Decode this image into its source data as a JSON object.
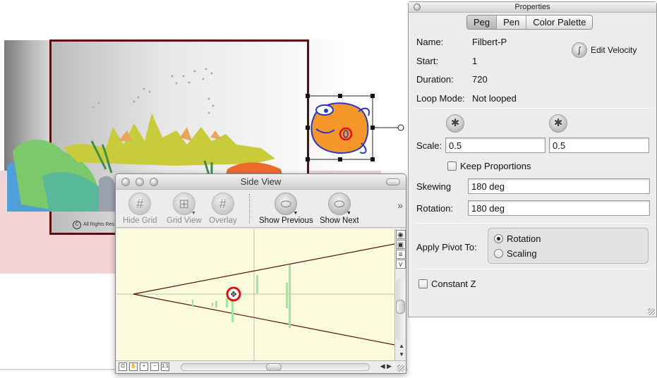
{
  "stage": {
    "copyright_text": "All Rights Res"
  },
  "side_view": {
    "title": "Side View",
    "toolbar": {
      "hide_grid": "Hide Grid",
      "grid_view": "Grid View",
      "overlay": "Overlay",
      "show_previous": "Show Previous",
      "show_next": "Show Next",
      "more": "»"
    },
    "bottom_icons": [
      "1:1"
    ]
  },
  "properties": {
    "title": "Properties",
    "tabs": [
      "Peg",
      "Pen",
      "Color Palette"
    ],
    "active_tab": "Peg",
    "name_label": "Name:",
    "name_value": "Filbert-P",
    "start_label": "Start:",
    "start_value": "1",
    "duration_label": "Duration:",
    "duration_value": "720",
    "loop_label": "Loop Mode:",
    "loop_value": "Not looped",
    "edit_velocity": "Edit Velocity",
    "scale_label": "Scale:",
    "scale_x": "0.5",
    "scale_y": "0.5",
    "keep_proportions": "Keep Proportions",
    "skewing_label": "Skewing",
    "skewing_value": "180 deg",
    "rotation_label": "Rotation:",
    "rotation_value": "180 deg",
    "apply_pivot_label": "Apply Pivot To:",
    "pivot_rotation": "Rotation",
    "pivot_scaling": "Scaling",
    "pivot_selected": "Rotation",
    "constant_z": "Constant Z"
  },
  "colors": {
    "frame_border": "#5a1010",
    "side_view_bg": "#fcfbdd",
    "fish_orange": "#f5962a",
    "fish_outline": "#2a36c8",
    "pivot_red": "#e01010",
    "camera_line": "#5a1010",
    "onion_green": "#9ee89a"
  }
}
